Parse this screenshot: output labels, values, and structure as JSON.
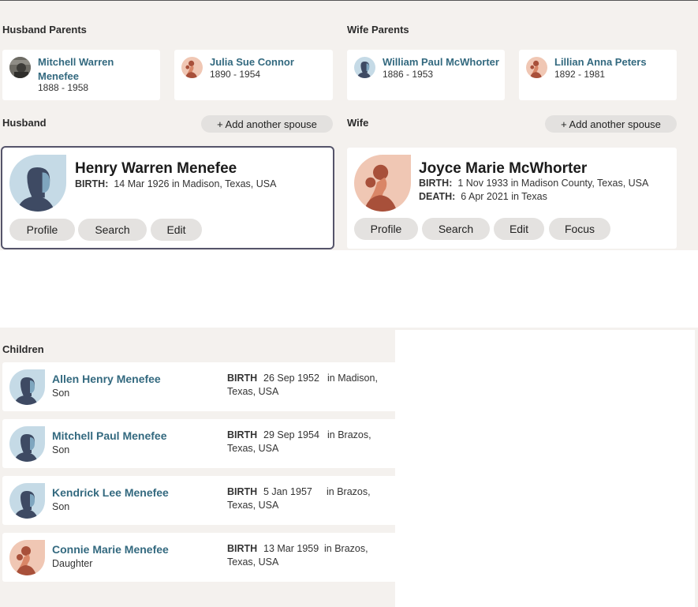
{
  "sections": {
    "husband_parents": "Husband Parents",
    "wife_parents": "Wife Parents",
    "husband": "Husband",
    "wife": "Wife",
    "children": "Children"
  },
  "parents": [
    {
      "name": "Mitchell Warren Menefee",
      "dates": "1888 - 1958",
      "avatar": "photo-avatar"
    },
    {
      "name": "Julia Sue Connor",
      "dates": "1890 - 1954",
      "avatar": "female-avatar"
    },
    {
      "name": "William Paul McWhorter",
      "dates": "1886 - 1953",
      "avatar": "male-avatar"
    },
    {
      "name": "Lillian Anna Peters",
      "dates": "1892 - 1981",
      "avatar": "female-avatar"
    }
  ],
  "add_spouse_label": "+ Add another spouse",
  "husband": {
    "name": "Henry Warren Menefee",
    "birth_label": "BIRTH:",
    "birth": "14 Mar 1926 in Madison, Texas, USA",
    "buttons": {
      "profile": "Profile",
      "search": "Search",
      "edit": "Edit"
    }
  },
  "wife": {
    "name": "Joyce Marie McWhorter",
    "birth_label": "BIRTH:",
    "birth": "1 Nov 1933 in Madison County, Texas, USA",
    "death_label": "DEATH:",
    "death": "6 Apr 2021 in Texas",
    "buttons": {
      "profile": "Profile",
      "search": "Search",
      "edit": "Edit",
      "focus": "Focus"
    }
  },
  "children": [
    {
      "name": "Allen Henry Menefee",
      "relation": "Son",
      "birth_label": "BIRTH",
      "date": "26 Sep 1952",
      "place1": "in Madison,",
      "place2": "Texas, USA",
      "avatar": "male-avatar"
    },
    {
      "name": "Mitchell Paul Menefee",
      "relation": "Son",
      "birth_label": "BIRTH",
      "date": "29 Sep 1954",
      "place1": "in Brazos,",
      "place2": "Texas, USA",
      "avatar": "male-avatar"
    },
    {
      "name": "Kendrick Lee Menefee",
      "relation": "Son",
      "birth_label": "BIRTH",
      "date": "5 Jan 1957",
      "place1": "in Brazos,",
      "place2": "Texas, USA",
      "avatar": "male-avatar"
    },
    {
      "name": "Connie Marie Menefee",
      "relation": "Daughter",
      "birth_label": "BIRTH",
      "date": "13 Mar 1959",
      "place1": "in Brazos,",
      "place2": "Texas, USA",
      "avatar": "female-avatar"
    }
  ],
  "colors": {
    "background": "#f4f1ee",
    "link": "#33697f",
    "male_avatar_bg": "#c5dae6",
    "male_avatar_fg": "#3e4a63",
    "female_avatar_bg": "#f0c7b4",
    "female_avatar_fg": "#a8503a",
    "selected_border": "#55546a"
  }
}
